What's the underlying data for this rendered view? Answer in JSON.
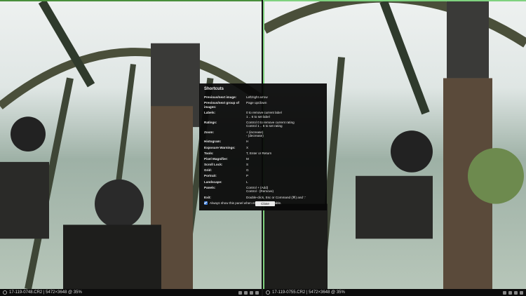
{
  "left_status": {
    "text": "17-119-0748.CR2 | 5472×3648 @ 35%"
  },
  "right_status": {
    "text": "17-119-0755.CR2 | 5472×3648 @ 35%"
  },
  "shortcuts": {
    "title": "Shortcuts",
    "rows": [
      {
        "key": "Previous/next image:",
        "values": [
          "Left/right arrow"
        ]
      },
      {
        "key": "Previous/next group of images:",
        "values": [
          "Page up/down"
        ]
      },
      {
        "key": "Labels:",
        "values": [
          "0 to remove current label",
          "1 .. 6 to set label"
        ]
      },
      {
        "key": "Ratings:",
        "values": [
          "Control 0 to remove current rating",
          "Control 1 .. 6 to set rating"
        ]
      },
      {
        "key": "Zoom:",
        "values": [
          "+ (increase)",
          "- (decrease)"
        ]
      },
      {
        "key": "Histogram:",
        "values": [
          "H"
        ]
      },
      {
        "key": "Exposure Warnings:",
        "values": [
          "X"
        ]
      },
      {
        "key": "Tools:",
        "values": [
          "T, Enter or Return"
        ]
      },
      {
        "key": "Pixel Magnifier:",
        "values": [
          "M"
        ]
      },
      {
        "key": "Scroll Lock:",
        "values": [
          "S"
        ]
      },
      {
        "key": "Grid:",
        "values": [
          "G"
        ]
      },
      {
        "key": "Portrait:",
        "values": [
          "P"
        ]
      },
      {
        "key": "Landscape:",
        "values": [
          "L"
        ]
      },
      {
        "key": "Panels:",
        "values": [
          "Control + (Add)",
          "Control - (Remove)"
        ]
      },
      {
        "key": "Exit:",
        "values": [
          "Double-click, Esc or Command (⌘) and '.'"
        ]
      }
    ],
    "checkbox_label": "Always show this panel when entering Light Table.",
    "checkbox_checked": true,
    "close_label": "Close"
  }
}
